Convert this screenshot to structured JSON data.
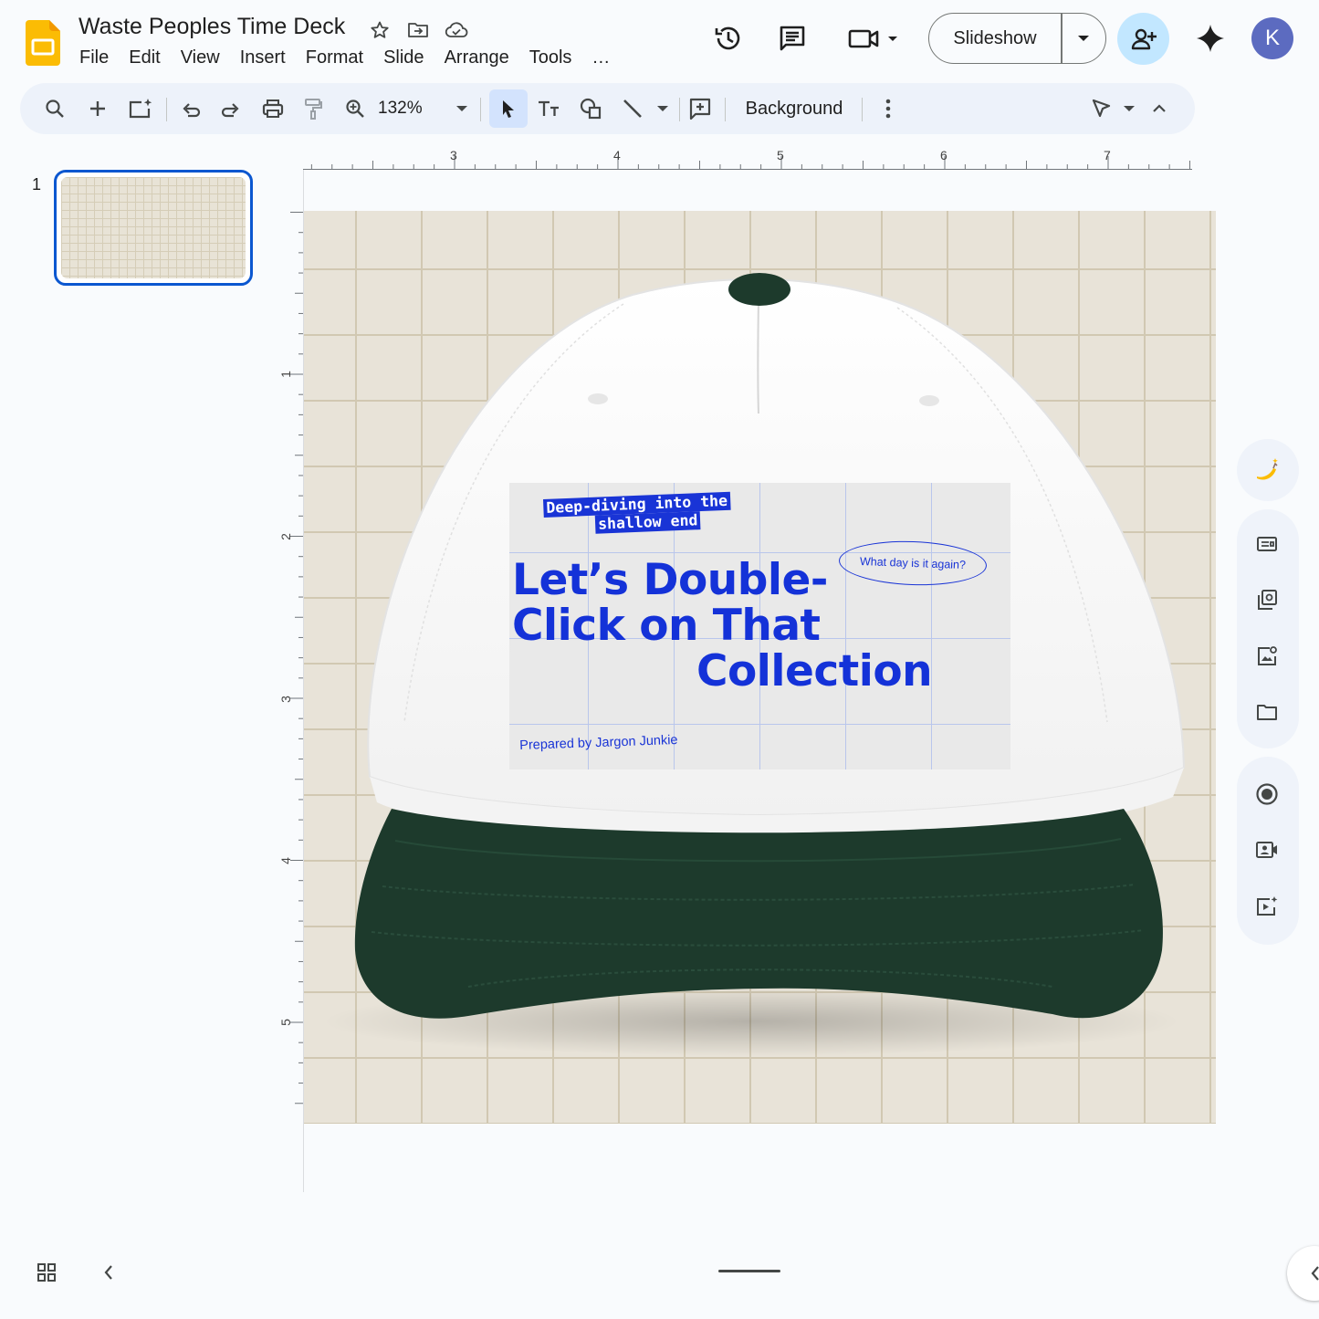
{
  "app": {
    "title": "Waste Peoples Time Deck"
  },
  "menu": [
    "File",
    "Edit",
    "View",
    "Insert",
    "Format",
    "Slide",
    "Arrange",
    "Tools",
    "…"
  ],
  "header": {
    "slideshow_label": "Slideshow",
    "avatar_initial": "K"
  },
  "toolbar": {
    "zoom": "132%",
    "background_label": "Background"
  },
  "filmstrip": {
    "slide_number": "1"
  },
  "rulers": {
    "top": [
      "3",
      "4",
      "5",
      "6",
      "7"
    ],
    "left": [
      "1",
      "2",
      "3",
      "4",
      "5"
    ]
  },
  "slide": {
    "tagline_line1": "Deep-diving into the",
    "tagline_line2": "shallow end",
    "headline_line1": "Let’s Double-",
    "headline_line2": "Click on That",
    "headline_line3": "Collection",
    "bubble": "What day is it again?",
    "byline": "Prepared by Jargon Junkie"
  },
  "colors": {
    "accent": "#0b57d0",
    "label_blue": "#1934d6",
    "brim_green": "#1d3a2c",
    "share_bg": "#c2e7ff",
    "avatar_bg": "#5c6bc0"
  },
  "icons": [
    "slides-logo",
    "star-icon",
    "move-folder-icon",
    "cloud-icon",
    "history-icon",
    "comment-icon",
    "meet-icon",
    "dropdown-icon",
    "add-person-icon",
    "gemini-icon",
    "search-icon",
    "plus-icon",
    "new-slide-icon",
    "undo-icon",
    "redo-icon",
    "print-icon",
    "paint-format-icon",
    "zoom-icon",
    "select-icon",
    "textbox-icon",
    "shapes-icon",
    "line-icon",
    "comment-add-icon",
    "more-icon",
    "pen-icon",
    "collapse-up-icon",
    "banana-icon",
    "slides-panel-icon",
    "copy-icon",
    "image-icon",
    "folder-icon",
    "record-icon",
    "camera-icon",
    "video-add-icon",
    "grid-view-icon",
    "chevron-left-icon"
  ]
}
